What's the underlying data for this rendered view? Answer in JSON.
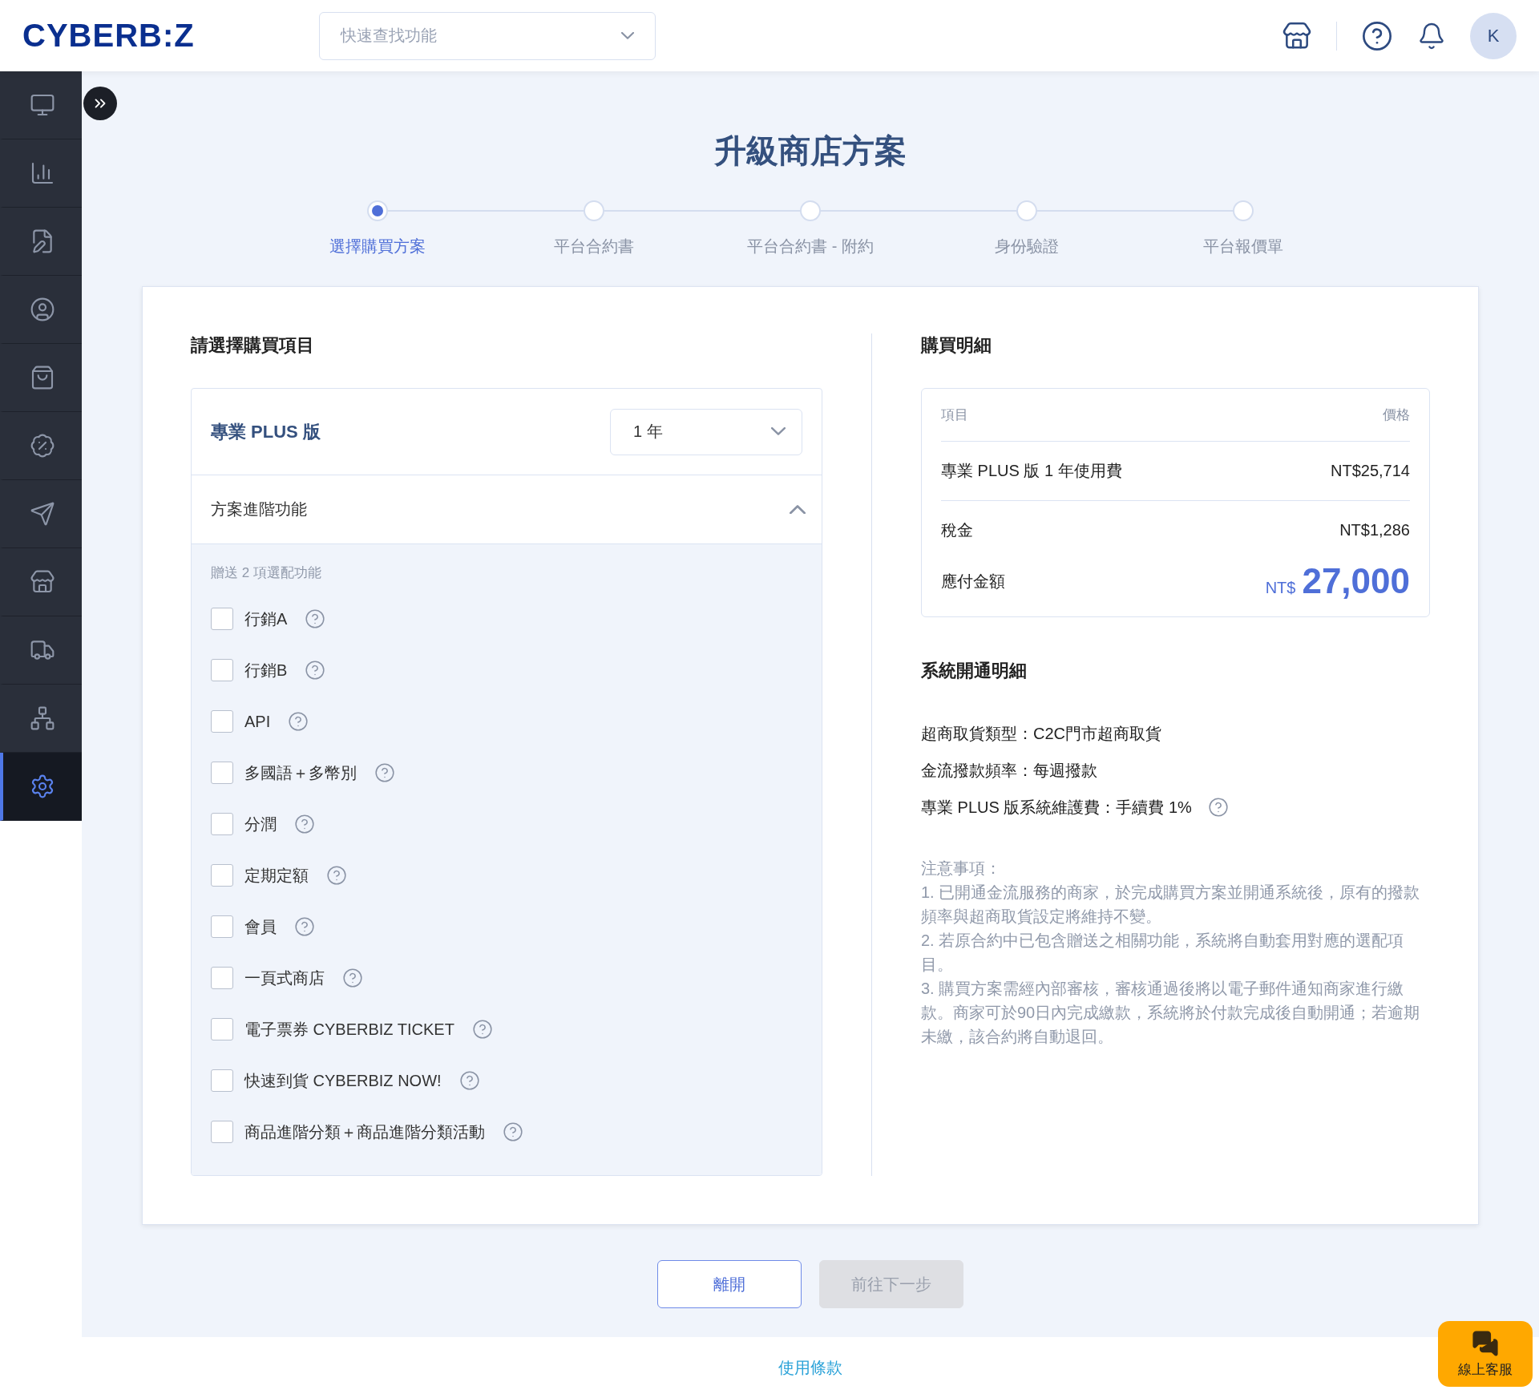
{
  "header": {
    "logo": "CYBERB:Z",
    "search": {
      "placeholder": "快速查找功能"
    },
    "avatar": "K"
  },
  "sidebar": {
    "items": [
      {
        "selected": false
      },
      {
        "selected": false
      },
      {
        "selected": false
      },
      {
        "selected": false
      },
      {
        "selected": false
      },
      {
        "selected": false
      },
      {
        "selected": false
      },
      {
        "selected": false
      },
      {
        "selected": false
      },
      {
        "selected": false
      },
      {
        "selected": true
      }
    ]
  },
  "page_title": "升級商店方案",
  "steps": [
    {
      "label": "選擇購買方案",
      "selected": true
    },
    {
      "label": "平台合約書",
      "selected": false
    },
    {
      "label": "平台合約書 - 附約",
      "selected": false
    },
    {
      "label": "身份驗證",
      "selected": false
    },
    {
      "label": "平台報價單",
      "selected": false
    }
  ],
  "purchase": {
    "title": "請選擇購買項目",
    "plan": "專業 PLUS 版",
    "duration": "1 年",
    "advanced": {
      "title": "方案進階功能",
      "expanded": true,
      "note": "贈送 2 項選配功能",
      "options": [
        {
          "label": "行銷A",
          "checked": false
        },
        {
          "label": "行銷B",
          "checked": false
        },
        {
          "label": "API",
          "checked": false
        },
        {
          "label": "多國語＋多幣別",
          "checked": false
        },
        {
          "label": "分潤",
          "checked": false
        },
        {
          "label": "定期定額",
          "checked": false
        },
        {
          "label": "會員",
          "checked": false
        },
        {
          "label": "一頁式商店",
          "checked": false
        },
        {
          "label": "電子票券 CYBERBIZ TICKET",
          "checked": false
        },
        {
          "label": "快速到貨 CYBERBIZ NOW!",
          "checked": false
        },
        {
          "label": "商品進階分類＋商品進階分類活動",
          "checked": false
        }
      ]
    }
  },
  "details": {
    "title": "購買明細",
    "columns": [
      "項目",
      "價格"
    ],
    "rows": [
      {
        "item": "專業 PLUS 版 1 年使用費",
        "price": "NT$25,714"
      },
      {
        "item": "稅金",
        "price": "NT$1,286"
      }
    ],
    "total": {
      "label": "應付金額",
      "currency": "NT$",
      "amount": "27,000"
    }
  },
  "activation": {
    "title": "系統開通明細",
    "lines": [
      {
        "text": "超商取貨類型：C2C門市超商取貨",
        "help": false
      },
      {
        "text": "金流撥款頻率：每週撥款",
        "help": false
      },
      {
        "text": "專業 PLUS 版系統維護費：手續費 1%",
        "help": true
      }
    ],
    "notes": [
      "注意事項：",
      "1. 已開通金流服務的商家，於完成購買方案並開通系統後，原有的撥款頻率與超商取貨設定將維持不變。",
      "2. 若原合約中已包含贈送之相關功能，系統將自動套用對應的選配項目。",
      "3. 購買方案需經內部審核，審核通過後將以電子郵件通知商家進行繳款。商家可於90日內完成繳款，系統將於付款完成後自動開通；若逾期未繳，該合約將自動退回。"
    ]
  },
  "buttons": [
    {
      "label": "離開",
      "disabled": false
    },
    {
      "label": "前往下一步",
      "disabled": true
    }
  ],
  "footer_link": "使用條款",
  "chat_button": "線上客服"
}
